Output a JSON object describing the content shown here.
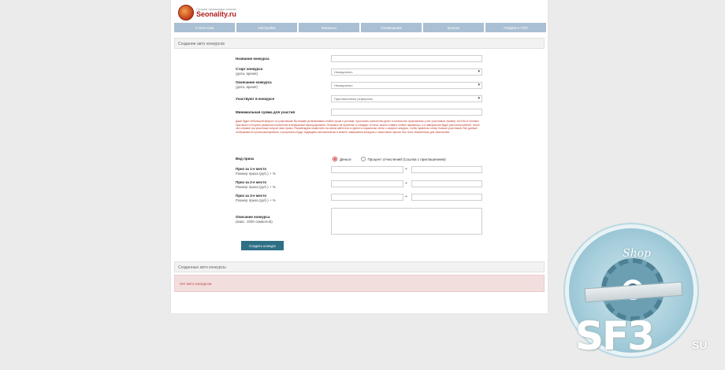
{
  "logo": {
    "tagline": "Лучшие промокоды сезона",
    "name": "Seonality.ru"
  },
  "nav": [
    "Статистика",
    "Настройки",
    "Финансы",
    "Оповещения",
    "Купоны",
    "Пойдём к ТОП"
  ],
  "section_create": "Создание авто конкурсов",
  "form": {
    "name_label": "Название конкурса",
    "start_label": "Старт конкурса",
    "start_sub": "(дата, время)",
    "start_value": "Немедленно",
    "end_label": "Окончание конкурса",
    "end_sub": "(дата, время)",
    "end_value": "Немедленно",
    "participants_label": "Участвуют в конкурсе",
    "participants_value": "Приглашенные рефералы",
    "min_amount_label": "Минимальная сумма для участия",
    "warning": "Даже будет небольшой прирост по участникам! Вы вправе устанавливать любые сроки и условия, просчитать количество денег и количество прорезанных у нас участников, пример: хотя бы 5 человек пригласил и получил указанное количество в выбранный период времени. Опираясь на принятые и стандарт отсчета, можно ставить любые параметры, а в завершении будет рассчитан рейтинг, после чего первые три участника получат свои призы. Рекомендуем оповестить на своем сайте или в группе в социальных сетях о запуске конкурса, чтобы привлечь к нему больше участников. Все данные отображаются в реальном времени, а результаты будут подведены автоматически в момент завершения конкурса и начисления призов. Все поля обязательны для заполнения.",
    "prize_label": "Вид приза",
    "prize_option_money": "Деньги",
    "prize_option_percent": "Процент отчислений (Ссылка с приглашением)",
    "place1_label": "Приз за 1-е место",
    "place1_sub": "Размер приза (руб.) + %",
    "place2_label": "Приз за 2-е место",
    "place2_sub": "Размер приза (руб.) + %",
    "place3_label": "Приз за 3-е место",
    "place3_sub": "Размер приза (руб.) + %",
    "plus_sign": "+",
    "desc_label": "Описание конкурса",
    "desc_sub": "(макс. 1000 символов)",
    "create_button": "Создать конкурс"
  },
  "section_created": "Созданные авто конкурсы",
  "empty_alert": "Нет авто конкурсов",
  "watermark": {
    "shop": "Shop",
    "brand": "SF3",
    "domain": "SU"
  }
}
